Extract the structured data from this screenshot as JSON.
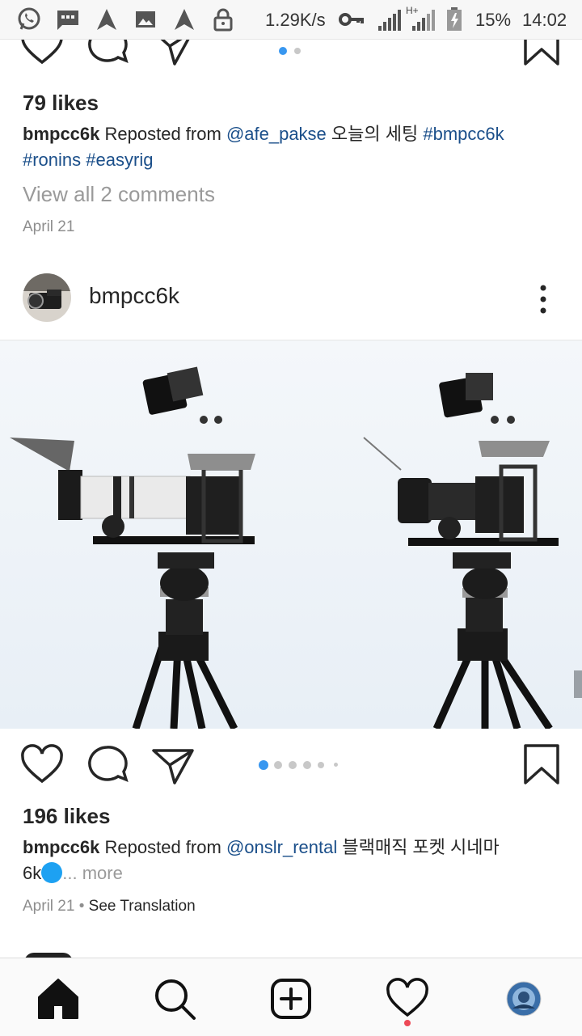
{
  "statusbar": {
    "net_speed": "1.29K/s",
    "network_type": "H+",
    "battery": "15%",
    "time": "14:02",
    "icons": [
      "whatsapp-icon",
      "message-icon",
      "navigation-icon",
      "image-icon",
      "navigation-icon",
      "lock-icon",
      "key-icon",
      "signal-icon",
      "battery-icon"
    ]
  },
  "post1": {
    "likes": "79 likes",
    "username": "bmpcc6k",
    "reposted_from": "Reposted from",
    "handle": "@afe_pakse",
    "korean": "오늘의 세팅",
    "tags": [
      "#bmpcc6k",
      "#ronins",
      "#easyrig"
    ],
    "view_comments": "View all 2 comments",
    "date": "April 21"
  },
  "post2": {
    "username": "bmpcc6k",
    "likes": "196 likes",
    "caption_user": "bmpcc6k",
    "reposted_from": "Reposted from",
    "handle": "@onslr_rental",
    "korean": "블랙매직 포켓 시네마",
    "line2": "6k",
    "more": "... more",
    "date": "April 21",
    "separator": "•",
    "see_translation": "See Translation",
    "carousel_count": 5,
    "carousel_active": 0
  },
  "bottomnav": {
    "items": [
      "home-icon",
      "search-icon",
      "add-post-icon",
      "activity-heart-icon",
      "profile-avatar"
    ]
  },
  "colors": {
    "accent": "#3897f0",
    "link": "#1b4f8a",
    "notification": "#ed4956"
  }
}
